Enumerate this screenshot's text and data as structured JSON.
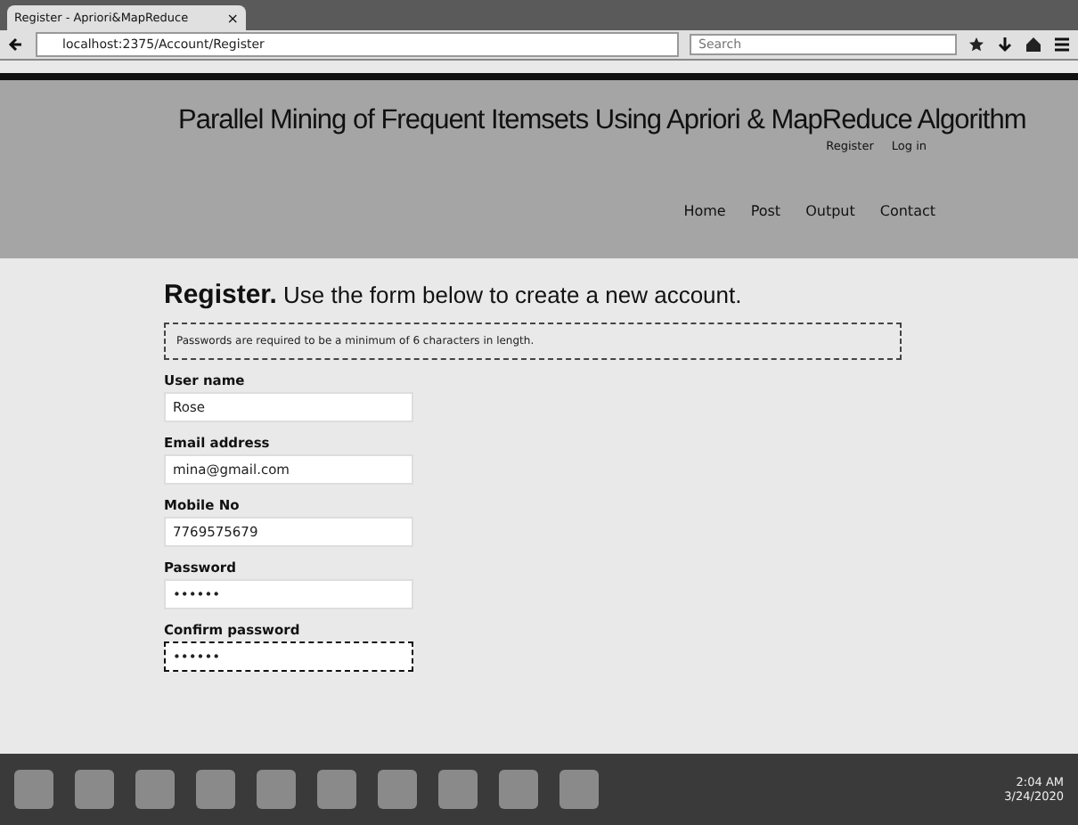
{
  "browser": {
    "tab_title": "Register - Apriori&MapReduce",
    "tab_close": "×",
    "address": "localhost:2375/Account/Register",
    "search_placeholder": "Search"
  },
  "header": {
    "title": "Parallel Mining of Frequent Itemsets Using Apriori & MapReduce Algorithm",
    "account_links": [
      "Register",
      "Log in"
    ],
    "nav": [
      "Home",
      "Post",
      "Output",
      "Contact"
    ]
  },
  "form": {
    "heading": "Register.",
    "subheading": "Use the form below to create a new account.",
    "notice": "Passwords are required to be a minimum of 6 characters in length.",
    "fields": [
      {
        "label": "User name",
        "value": "Rose",
        "focused": false
      },
      {
        "label": "Email address",
        "value": "mina@gmail.com",
        "focused": false
      },
      {
        "label": "Mobile No",
        "value": "7769575679",
        "focused": false
      },
      {
        "label": "Password",
        "value": "••••••",
        "focused": false
      },
      {
        "label": "Confirm password",
        "value": "••••••",
        "focused": true
      }
    ]
  },
  "taskbar": {
    "time": "2:04 AM",
    "date": "3/24/2020"
  }
}
